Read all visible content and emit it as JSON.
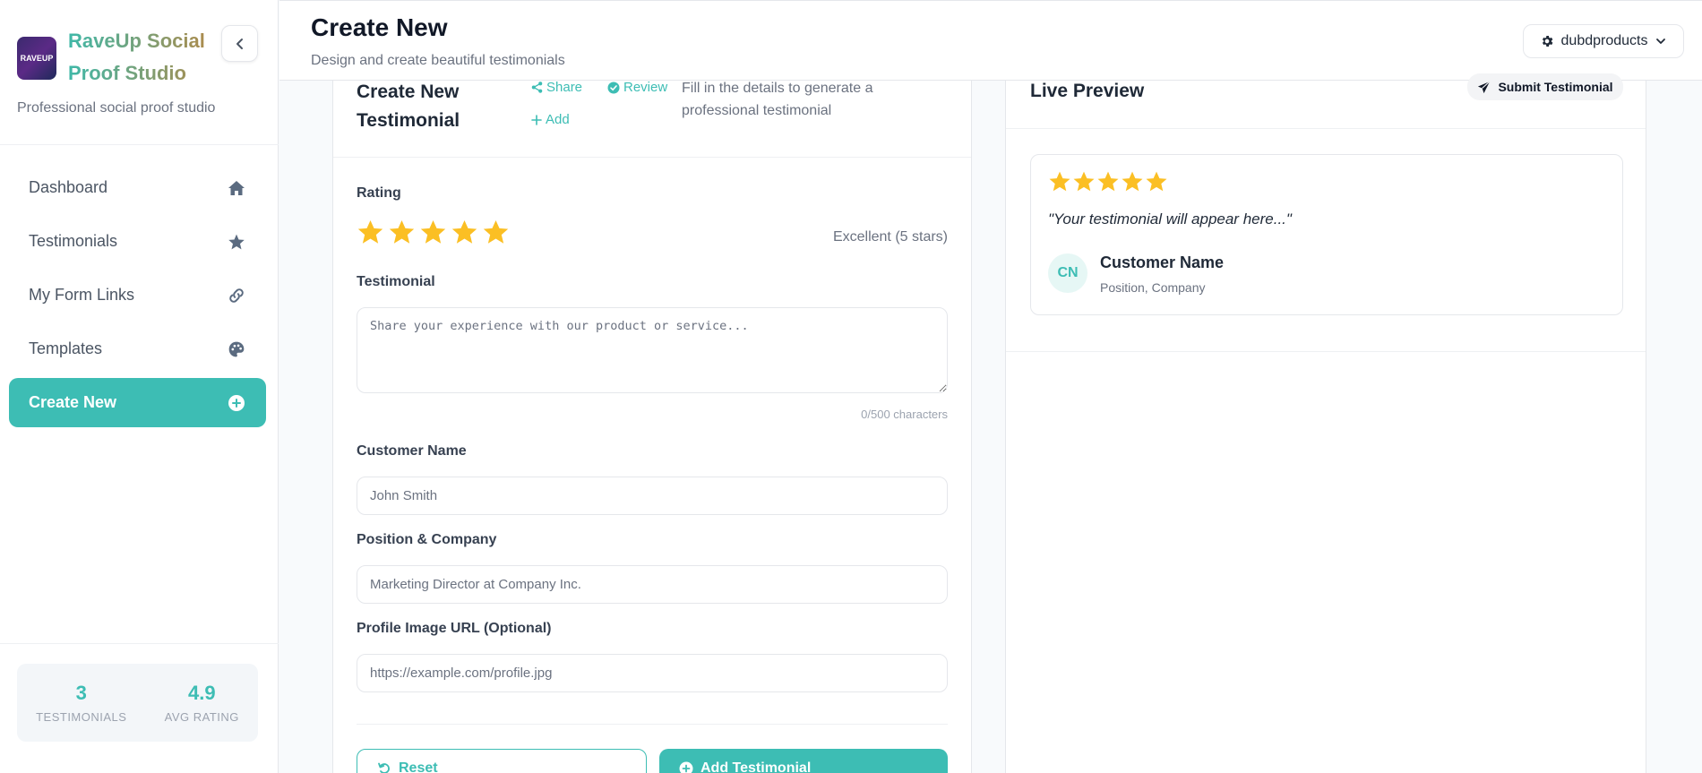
{
  "sidebar": {
    "brand_name": "RaveUp Social Proof Studio",
    "logo_text": "RAVEUP",
    "tagline": "Professional social proof studio",
    "items": [
      {
        "label": "Dashboard",
        "icon": "home-icon"
      },
      {
        "label": "Testimonials",
        "icon": "star-icon"
      },
      {
        "label": "My Form Links",
        "icon": "link-icon"
      },
      {
        "label": "Templates",
        "icon": "palette-icon"
      },
      {
        "label": "Create New",
        "icon": "plus-circle-icon",
        "active": true
      }
    ],
    "stats": [
      {
        "value": "3",
        "label": "TESTIMONIALS"
      },
      {
        "value": "4.9",
        "label": "AVG RATING"
      }
    ]
  },
  "header": {
    "title": "Create New",
    "subtitle": "Design and create beautiful testimonials",
    "user": "dubdproducts"
  },
  "form": {
    "title": "Create New Testimonial",
    "share_label": "Share",
    "review_label": "Review",
    "add_label": "Add",
    "description": "Fill in the details to generate a professional testimonial",
    "rating_label": "Rating",
    "rating_value": 5,
    "rating_text": "Excellent (5 stars)",
    "testimonial_label": "Testimonial",
    "testimonial_placeholder": "Share your experience with our product or service...",
    "char_count": "0/500 characters",
    "name_label": "Customer Name",
    "name_placeholder": "John Smith",
    "position_label": "Position & Company",
    "position_placeholder": "Marketing Director at Company Inc.",
    "image_label": "Profile Image URL (Optional)",
    "image_placeholder": "https://example.com/profile.jpg",
    "reset_label": "Reset",
    "submit_label": "Add Testimonial"
  },
  "preview": {
    "title": "Live Preview",
    "submit_label": "Submit Testimonial",
    "rating_value": 5,
    "quote": "\"Your testimonial will appear here...\"",
    "avatar_initials": "CN",
    "customer_name": "Customer Name",
    "customer_position": "Position, Company"
  },
  "colors": {
    "accent": "#3dbdb4",
    "star": "#fbbf24"
  }
}
